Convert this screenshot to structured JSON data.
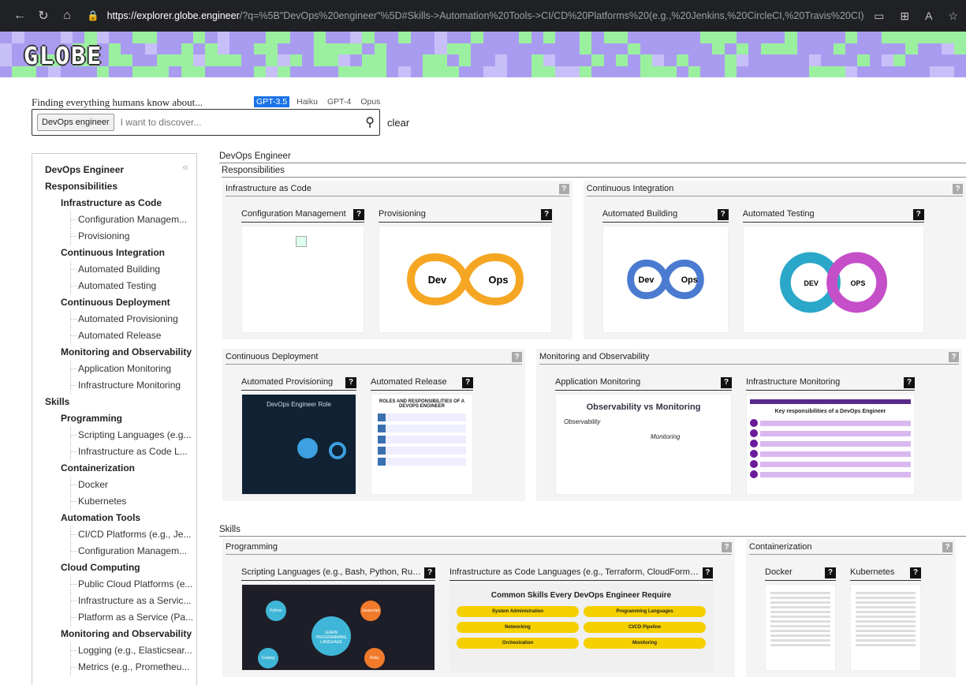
{
  "browser": {
    "url_host": "https://explorer.globe.engineer",
    "url_path": "/?q=%5B\"DevOps%20engineer\"%5D#Skills->Automation%20Tools->CI/CD%20Platforms%20(e.g.,%20Jenkins,%20CircleCI,%20Travis%20CI)"
  },
  "banner": {
    "logo": "GLOBE"
  },
  "search": {
    "tagline": "Finding everything humans know about...",
    "models": [
      "GPT-3.5",
      "Haiku",
      "GPT-4",
      "Opus"
    ],
    "chip": "DevOps engineer",
    "placeholder": "I want to discover...",
    "clear_label": "clear"
  },
  "sidebar": {
    "items": [
      {
        "level": 0,
        "label": "DevOps Engineer"
      },
      {
        "level": 0,
        "label": "Responsibilities"
      },
      {
        "level": 1,
        "label": "Infrastructure as Code"
      },
      {
        "level": 2,
        "label": "Configuration Managem..."
      },
      {
        "level": 2,
        "label": "Provisioning"
      },
      {
        "level": 1,
        "label": "Continuous Integration"
      },
      {
        "level": 2,
        "label": "Automated Building"
      },
      {
        "level": 2,
        "label": "Automated Testing"
      },
      {
        "level": 1,
        "label": "Continuous Deployment"
      },
      {
        "level": 2,
        "label": "Automated Provisioning"
      },
      {
        "level": 2,
        "label": "Automated Release"
      },
      {
        "level": 1,
        "label": "Monitoring and Observability"
      },
      {
        "level": 2,
        "label": "Application Monitoring"
      },
      {
        "level": 2,
        "label": "Infrastructure Monitoring"
      },
      {
        "level": 0,
        "label": "Skills"
      },
      {
        "level": 1,
        "label": "Programming"
      },
      {
        "level": 2,
        "label": "Scripting Languages (e.g..."
      },
      {
        "level": 2,
        "label": "Infrastructure as Code L..."
      },
      {
        "level": 1,
        "label": "Containerization"
      },
      {
        "level": 2,
        "label": "Docker"
      },
      {
        "level": 2,
        "label": "Kubernetes"
      },
      {
        "level": 1,
        "label": "Automation Tools"
      },
      {
        "level": 2,
        "label": "CI/CD Platforms (e.g., Je..."
      },
      {
        "level": 2,
        "label": "Configuration Managem..."
      },
      {
        "level": 1,
        "label": "Cloud Computing"
      },
      {
        "level": 2,
        "label": "Public Cloud Platforms (e..."
      },
      {
        "level": 2,
        "label": "Infrastructure as a Servic..."
      },
      {
        "level": 2,
        "label": "Platform as a Service (Pa..."
      },
      {
        "level": 1,
        "label": "Monitoring and Observability"
      },
      {
        "level": 2,
        "label": "Logging (e.g., Elasticsear..."
      },
      {
        "level": 2,
        "label": "Metrics (e.g., Prometheu..."
      }
    ]
  },
  "main": {
    "root_title": "DevOps Engineer",
    "responsibilities_title": "Responsibilities",
    "skills_title": "Skills",
    "resp_row1": [
      {
        "title": "Infrastructure as Code",
        "cards": [
          "Configuration Management",
          "Provisioning"
        ]
      },
      {
        "title": "Continuous Integration",
        "cards": [
          "Automated Building",
          "Automated Testing"
        ]
      }
    ],
    "resp_row2": [
      {
        "title": "Continuous Deployment",
        "cards": [
          "Automated Provisioning",
          "Automated Release"
        ]
      },
      {
        "title": "Monitoring and Observability",
        "cards": [
          "Application Monitoring",
          "Infrastructure Monitoring"
        ]
      }
    ],
    "skills_row": [
      {
        "title": "Programming",
        "cards": [
          "Scripting Languages (e.g., Bash, Python, Ruby)",
          "Infrastructure as Code Languages (e.g., Terraform, CloudFormation)"
        ]
      },
      {
        "title": "Containerization",
        "cards": [
          "Docker",
          "Kubernetes"
        ]
      }
    ],
    "img_text": {
      "dev": "Dev",
      "ops": "Ops",
      "obs_title": "Observability vs Monitoring",
      "obs": "Observability",
      "mon": "Monitoring",
      "key_resp": "Key responsibilities of a DevOps Engineer",
      "common_skills": "Common Skills Every DevOps Engineer Require",
      "skill_pills": [
        "System Administration",
        "Programming Languages",
        "Networking",
        "CI/CD Pipeline",
        "Orchestration",
        "Monitoring"
      ],
      "devops_role": "DevOps Engineer Role",
      "roles": "ROLES AND RESPONSIBILITIES OF A DEVOPS ENGINEER",
      "learn": "LEARN PROGRAMMING LANGUAGE",
      "langs": [
        "Python",
        "Javascript",
        "Golang",
        "Ruby"
      ]
    }
  }
}
